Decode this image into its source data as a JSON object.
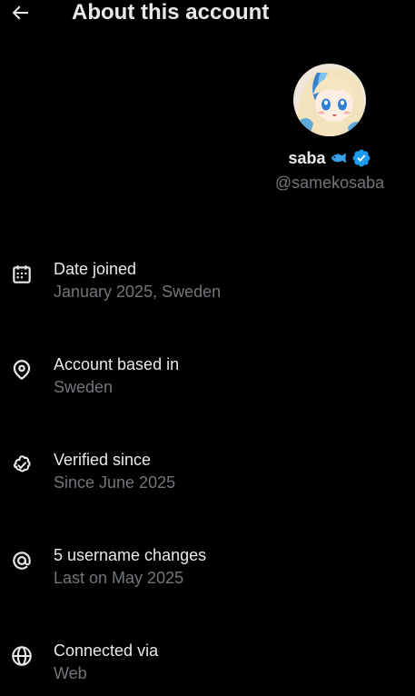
{
  "header": {
    "title": "About this account",
    "back_icon": "arrow-left-icon"
  },
  "profile": {
    "display_name": "saba",
    "emoji_icon": "fish-icon",
    "verified_icon": "verified-badge-icon",
    "handle": "@samekosaba"
  },
  "info": [
    {
      "icon": "calendar-icon",
      "title": "Date joined",
      "value": "January 2025, Sweden"
    },
    {
      "icon": "location-pin-icon",
      "title": "Account based in",
      "value": "Sweden"
    },
    {
      "icon": "verified-check-icon",
      "title": "Verified since",
      "value": "Since June 2025"
    },
    {
      "icon": "at-sign-icon",
      "title": "5 username changes",
      "value": "Last on May 2025"
    },
    {
      "icon": "globe-icon",
      "title": "Connected via",
      "value": "Web"
    }
  ],
  "colors": {
    "background": "#000000",
    "primary_text": "#e7e9ea",
    "secondary_text": "#71767b",
    "verified_blue": "#1d9bf0"
  }
}
